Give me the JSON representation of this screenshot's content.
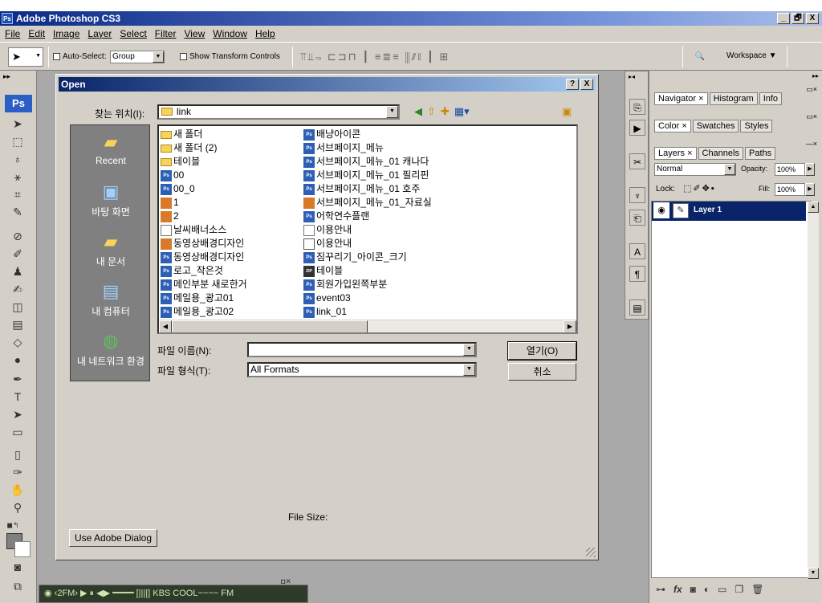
{
  "app": {
    "title": "Adobe Photoshop CS3",
    "badge": "Ps"
  },
  "window_buttons": [
    "_",
    "🗗",
    "X"
  ],
  "menu": [
    "File",
    "Edit",
    "Image",
    "Layer",
    "Select",
    "Filter",
    "View",
    "Window",
    "Help"
  ],
  "options_bar": {
    "auto_select_label": "Auto-Select:",
    "auto_select_value": "Group",
    "show_transform_label": "Show Transform Controls",
    "workspace_label": "Workspace ▼"
  },
  "toolbox": {
    "badge": "Ps"
  },
  "dialog": {
    "title": "Open",
    "help_btn": "?",
    "close_btn": "X",
    "look_in_label": "찾는 위치(I):",
    "look_in_value": "link",
    "places": [
      "Recent",
      "바탕 화면",
      "내 문서",
      "내 컴퓨터",
      "내 네트워크 환경"
    ],
    "files_col1": [
      {
        "name": "새 폴더",
        "type": "folder"
      },
      {
        "name": "새 폴더 (2)",
        "type": "folder"
      },
      {
        "name": "테이블",
        "type": "folder"
      },
      {
        "name": "00",
        "type": "ps"
      },
      {
        "name": "00_0",
        "type": "ps"
      },
      {
        "name": "1",
        "type": "img"
      },
      {
        "name": "2",
        "type": "img"
      },
      {
        "name": "날씨배너소스",
        "type": "doc"
      },
      {
        "name": "동영상배경디자인",
        "type": "img"
      },
      {
        "name": "동영상배경디자인",
        "type": "ps"
      },
      {
        "name": "로고_작은것",
        "type": "ps"
      },
      {
        "name": "메인부분 새로한거",
        "type": "ps"
      },
      {
        "name": "메일용_광고01",
        "type": "ps"
      },
      {
        "name": "메일용_광고02",
        "type": "ps"
      }
    ],
    "files_col2": [
      {
        "name": "배냥아이콘",
        "type": "ps"
      },
      {
        "name": "서브페이지_메뉴",
        "type": "ps"
      },
      {
        "name": "서브페이지_메뉴_01 캐나다",
        "type": "ps"
      },
      {
        "name": "서브페이지_메뉴_01 필리핀",
        "type": "ps"
      },
      {
        "name": "서브페이지_메뉴_01 호주",
        "type": "ps"
      },
      {
        "name": "서브페이지_메뉴_01_자료실",
        "type": "img"
      },
      {
        "name": "어학연수플랜",
        "type": "ps"
      },
      {
        "name": "이용안내",
        "type": "doc"
      },
      {
        "name": "이용안내",
        "type": "html"
      },
      {
        "name": "짐꾸리기_아이콘_크기",
        "type": "ps"
      },
      {
        "name": "테이블",
        "type": "zip"
      },
      {
        "name": "회원가입왼쪽부분",
        "type": "ps"
      },
      {
        "name": "event03",
        "type": "ps"
      },
      {
        "name": "link_01",
        "type": "ps"
      }
    ],
    "filename_label": "파일 이름(N):",
    "filename_value": "",
    "filetype_label": "파일 형식(T):",
    "filetype_value": "All Formats",
    "open_btn": "열기(O)",
    "cancel_btn": "취소",
    "file_size_label": "File Size:",
    "adobe_dialog_btn": "Use Adobe Dialog"
  },
  "panels": {
    "group1_tabs": [
      "Navigator ×",
      "Histogram",
      "Info"
    ],
    "group2_tabs": [
      "Color ×",
      "Swatches",
      "Styles"
    ],
    "group3_tabs": [
      "Layers ×",
      "Channels",
      "Paths"
    ],
    "blend_mode": "Normal",
    "opacity_label": "Opacity:",
    "opacity_value": "100%",
    "lock_label": "Lock:",
    "fill_label": "Fill:",
    "fill_value": "100%",
    "layer_name": "Layer 1"
  },
  "taskbar": {
    "text": "◉ ‹2FM› ▶ ⏸ ◀▶ ━━━━ [||||] KBS COOL~~~~ FM"
  }
}
